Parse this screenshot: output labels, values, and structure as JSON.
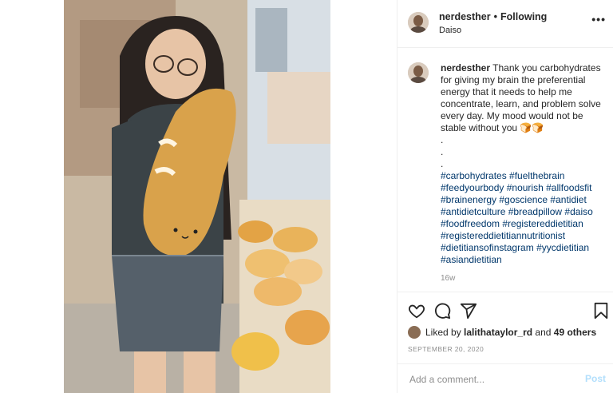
{
  "post": {
    "username": "nerdesther",
    "separator": "•",
    "following_label": "Following",
    "location": "Daiso",
    "more_label": "•••"
  },
  "caption": {
    "username": "nerdesther",
    "text": "Thank you carbohydrates for giving my brain the preferential energy that it needs to help me concentrate, learn, and problem solve every day. My mood would not be stable without you",
    "emoji": "🍞🍞",
    "dots": [
      ".",
      ".",
      "."
    ],
    "hashtags": [
      "#carbohydrates #fuelthebrain",
      "#feedyourbody #nourish #allfoodsfit",
      "#brainenergy #goscience #antidiet",
      "#antidietculture #breadpillow #daiso",
      "#foodfreedom #registereddietitian",
      "#registereddietitiannutritionist",
      "#dietitiansofinstagram #yycdietitian",
      "#asiandietitian"
    ],
    "time": "16w"
  },
  "likes": {
    "prefix": "Liked by",
    "user": "lalithataylor_rd",
    "and": "and",
    "count": "49 others"
  },
  "date": "SEPTEMBER 20, 2020",
  "comment": {
    "placeholder": "Add a comment...",
    "post_label": "Post"
  },
  "icons": [
    "heart-icon",
    "comment-icon",
    "share-icon",
    "bookmark-icon",
    "more-icon"
  ]
}
